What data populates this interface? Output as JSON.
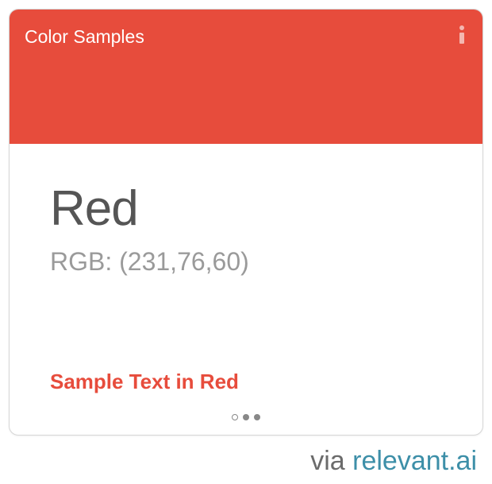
{
  "card": {
    "title": "Color Samples",
    "header_color": "#e74c3c",
    "info_icon": "info-icon",
    "color_name": "Red",
    "rgb_text": "RGB: (231,76,60)",
    "sample_text": "Sample Text in Red",
    "sample_text_color": "#e74c3c",
    "pager": {
      "total": 3,
      "active_index": 0
    }
  },
  "footer": {
    "via": "via ",
    "brand": "relevant.ai",
    "brand_color": "#3d8fa8"
  }
}
